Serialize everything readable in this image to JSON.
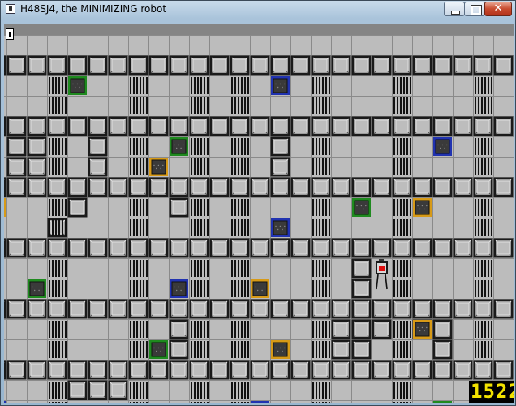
{
  "window": {
    "title": "H48SJ4, the MINIMIZING robot"
  },
  "hud": {
    "score": "1522"
  },
  "colors": {
    "floor": "#bcbcbc",
    "gridline": "#8a8a8a",
    "wall_dark": "#1a1a1a",
    "wall_light": "#e0e0e0",
    "target_green": "#1f8a1f",
    "target_blue": "#2133b0",
    "target_orange": "#d79a17"
  },
  "board": {
    "cols": 26,
    "rows": 19,
    "wall_rows": [
      1,
      4,
      7,
      10,
      13,
      16
    ],
    "vents": [
      [
        3,
        2
      ],
      [
        3,
        3
      ],
      [
        7,
        2
      ],
      [
        7,
        3
      ],
      [
        10,
        2
      ],
      [
        10,
        3
      ],
      [
        12,
        2
      ],
      [
        12,
        3
      ],
      [
        16,
        2
      ],
      [
        16,
        3
      ],
      [
        20,
        2
      ],
      [
        20,
        3
      ],
      [
        24,
        2
      ],
      [
        24,
        3
      ],
      [
        3,
        5
      ],
      [
        3,
        6
      ],
      [
        7,
        5
      ],
      [
        7,
        6
      ],
      [
        10,
        5
      ],
      [
        10,
        6
      ],
      [
        12,
        5
      ],
      [
        12,
        6
      ],
      [
        16,
        5
      ],
      [
        16,
        6
      ],
      [
        20,
        5
      ],
      [
        20,
        6
      ],
      [
        24,
        5
      ],
      [
        24,
        6
      ],
      [
        3,
        8
      ],
      [
        3,
        9
      ],
      [
        7,
        8
      ],
      [
        7,
        9
      ],
      [
        10,
        8
      ],
      [
        10,
        9
      ],
      [
        12,
        8
      ],
      [
        12,
        9
      ],
      [
        16,
        8
      ],
      [
        16,
        9
      ],
      [
        20,
        8
      ],
      [
        20,
        9
      ],
      [
        24,
        8
      ],
      [
        24,
        9
      ],
      [
        3,
        11
      ],
      [
        3,
        12
      ],
      [
        7,
        11
      ],
      [
        7,
        12
      ],
      [
        10,
        11
      ],
      [
        10,
        12
      ],
      [
        12,
        11
      ],
      [
        12,
        12
      ],
      [
        16,
        11
      ],
      [
        16,
        12
      ],
      [
        20,
        11
      ],
      [
        20,
        12
      ],
      [
        24,
        11
      ],
      [
        24,
        12
      ],
      [
        3,
        14
      ],
      [
        3,
        15
      ],
      [
        7,
        14
      ],
      [
        7,
        15
      ],
      [
        10,
        14
      ],
      [
        10,
        15
      ],
      [
        12,
        14
      ],
      [
        12,
        15
      ],
      [
        16,
        14
      ],
      [
        16,
        15
      ],
      [
        20,
        14
      ],
      [
        20,
        15
      ],
      [
        24,
        14
      ],
      [
        24,
        15
      ],
      [
        3,
        17
      ],
      [
        3,
        18
      ],
      [
        7,
        17
      ],
      [
        7,
        18
      ],
      [
        10,
        17
      ],
      [
        10,
        18
      ],
      [
        12,
        17
      ],
      [
        12,
        18
      ],
      [
        16,
        17
      ],
      [
        16,
        18
      ],
      [
        20,
        17
      ],
      [
        20,
        18
      ],
      [
        24,
        17
      ],
      [
        24,
        18
      ]
    ],
    "blocks": [
      [
        1,
        5
      ],
      [
        1,
        6
      ],
      [
        2,
        5
      ],
      [
        2,
        6
      ],
      [
        5,
        5
      ],
      [
        5,
        6
      ],
      [
        14,
        5
      ],
      [
        14,
        6
      ],
      [
        4,
        8
      ],
      [
        9,
        8
      ],
      [
        3,
        9
      ],
      [
        18,
        11
      ],
      [
        18,
        12
      ],
      [
        9,
        14
      ],
      [
        17,
        14
      ],
      [
        18,
        14
      ],
      [
        19,
        14
      ],
      [
        21,
        14
      ],
      [
        22,
        14
      ],
      [
        9,
        15
      ],
      [
        17,
        15
      ],
      [
        18,
        15
      ],
      [
        22,
        15
      ],
      [
        4,
        17
      ],
      [
        5,
        17
      ],
      [
        6,
        17
      ]
    ],
    "targets": [
      {
        "col": 4,
        "row": 2,
        "color": "green"
      },
      {
        "col": 14,
        "row": 2,
        "color": "blue"
      },
      {
        "col": 9,
        "row": 5,
        "color": "green"
      },
      {
        "col": 22,
        "row": 5,
        "color": "blue"
      },
      {
        "col": 8,
        "row": 6,
        "color": "orange"
      },
      {
        "col": 0,
        "row": 8,
        "color": "orange"
      },
      {
        "col": 18,
        "row": 8,
        "color": "green"
      },
      {
        "col": 21,
        "row": 8,
        "color": "orange"
      },
      {
        "col": 14,
        "row": 9,
        "color": "blue"
      },
      {
        "col": 2,
        "row": 12,
        "color": "green"
      },
      {
        "col": 9,
        "row": 12,
        "color": "blue"
      },
      {
        "col": 13,
        "row": 12,
        "color": "orange"
      },
      {
        "col": 21,
        "row": 14,
        "color": "orange"
      },
      {
        "col": 8,
        "row": 15,
        "color": "green"
      },
      {
        "col": 14,
        "row": 15,
        "color": "orange"
      },
      {
        "col": 0,
        "row": 18,
        "color": "blue"
      },
      {
        "col": 13,
        "row": 18,
        "color": "blue"
      },
      {
        "col": 22,
        "row": 18,
        "color": "green"
      }
    ],
    "robot": {
      "col": 19,
      "row": 11
    }
  }
}
